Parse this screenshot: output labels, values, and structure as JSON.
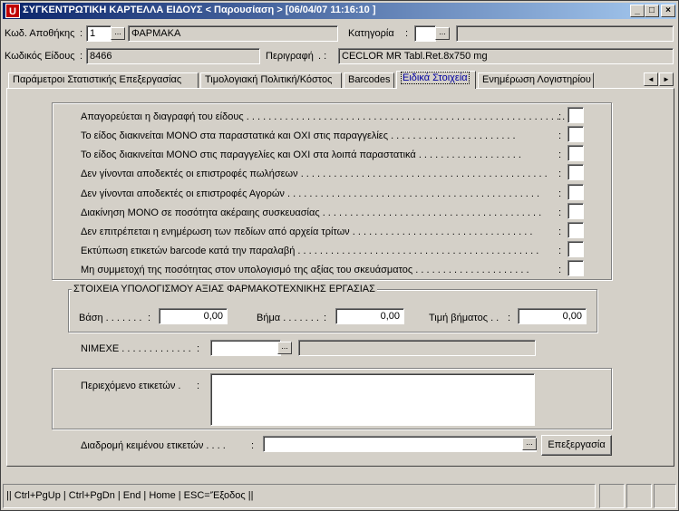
{
  "window": {
    "title": "ΣΥΓΚΕΝΤΡΩΤΙΚΗ ΚΑΡΤΕΛΛΑ ΕΙΔΟΥΣ < Παρουσίαση >   [06/04/07 11:16:10  ]",
    "app_icon_letter": "U",
    "min_glyph": "_",
    "max_glyph": "□",
    "close_glyph": "×"
  },
  "header": {
    "warehouse_label": "Κωδ. Αποθήκης",
    "warehouse_code": "1",
    "warehouse_name": "ΦΑΡΜΑΚΑ",
    "category_label": "Κατηγορία",
    "item_code_label": "Κωδικός Είδους",
    "item_code": "8466",
    "description_label": "Περιγραφή",
    "description": "CECLOR MR Tabl.Ret.8x750 mg",
    "lookup_glyph": "...",
    "colon": ":"
  },
  "tabs": [
    {
      "label": "Παράμετροι Στατιστικής Επεξεργασίας"
    },
    {
      "label": "Τιμολογιακή Πολιτική/Κόστος"
    },
    {
      "label": "Barcodes"
    },
    {
      "label": "Ειδικά Στοιχεία"
    },
    {
      "label": "Ενημέρωση Λογιστηρίου"
    }
  ],
  "tab_scroll": {
    "left": "◄",
    "right": "►"
  },
  "flags": [
    {
      "label": "Απαγορεύεται η διαγραφή του είδους . . . . . . . . . . . . . . . . . . . . . . . . . . . . . . . . . . . . . . . . . . . . . . . . . . . . . . . . . . . ."
    },
    {
      "label": "Το είδος διακινείται ΜΟΝΟ στα παραστατικά και ΟΧΙ στις παραγγελίες . . . . . . . . . . . . . . . . . . . . . . ."
    },
    {
      "label": "Το είδος διακινείται ΜΟΝΟ στις παραγγελίες και ΟΧΙ στα λοιπά παραστατικά . . . . . . . . . . . . . . . . . . ."
    },
    {
      "label": "Δεν γίνονται αποδεκτές οι επιστροφές πωλήσεων . . . . . . . . . . . . . . . . . . . . . . . . . . . . . . . . . . . . . . . . . . . . ."
    },
    {
      "label": "Δεν γίνονται αποδεκτές οι επιστροφές Αγορών . . . . . . . . . . . . . . . . . . . . . . . . . . . . . . . . . . . . . . . . . . . . . ."
    },
    {
      "label": "Διακίνηση ΜΟΝΟ σε ποσότητα ακέραιης συσκευασίας . . . . . . . . . . . . . . . . . . . . . . . . . . . . . . . . . . . . . . . ."
    },
    {
      "label": "Δεν επιτρέπεται η ενημέρωση των πεδίων από αρχεία τρίτων . . . . . . . . . . . . . . . . . . . . . . . . . . . . . . . . ."
    },
    {
      "label": "Εκτύπωση ετικετών barcode κατά την παραλαβή . . . . . . . . . . . . . . . . . . . . . . . . . . . . . . . . . . . . . . . . . . . ."
    },
    {
      "label": "Μη συμμετοχή της ποσότητας στον υπολογισμό της αξίας του σκευάσματος . . . . . . . . . . . . . . . . . . . . ."
    }
  ],
  "calc_group": {
    "legend": "ΣΤΟΙΧΕΙΑ ΥΠΟΛΟΓΙΣΜΟΥ ΑΞΙΑΣ ΦΑΡΜΑΚΟΤΕΧΝΙΚΗΣ ΕΡΓΑΣΙΑΣ",
    "base_label": "Βάση . . . . . . .",
    "base_value": "0,00",
    "step_label": "Βήμα . . . . . . .",
    "step_value": "0,00",
    "step_price_label": "Τιμή βήματος . .",
    "step_price_value": "0,00"
  },
  "nimexe": {
    "label": "ΝΙΜΕΧΕ . . . . . . . . . . . . .",
    "value": "",
    "description": ""
  },
  "labels_group": {
    "content_label": "Περιεχόμενο ετικετών  .",
    "content_value": "",
    "path_label": "Διαδρομή κειμένου ετικετών . . . .",
    "path_value": "",
    "edit_button": "Επεξεργασία"
  },
  "statusbar": {
    "shortcuts": "|| Ctrl+PgUp | Ctrl+PgDn | End | Home | ESC='Έξοδος ||"
  }
}
